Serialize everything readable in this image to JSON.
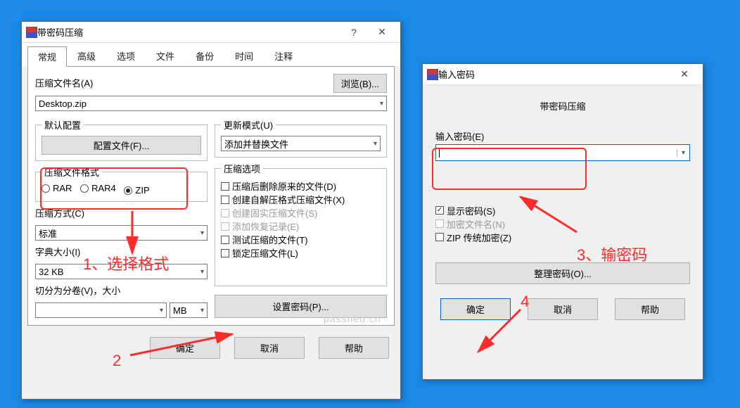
{
  "main": {
    "title": "带密码压缩",
    "tabs": [
      "常规",
      "高级",
      "选项",
      "文件",
      "备份",
      "时间",
      "注释"
    ],
    "activeTab": 0,
    "archiveNameLabel": "压缩文件名(A)",
    "browse": "浏览(B)...",
    "archiveName": "Desktop.zip",
    "defaultCfg": {
      "legend": "默认配置",
      "profiles": "配置文件(F)..."
    },
    "updateMode": {
      "legend": "更新模式(U)",
      "value": "添加并替换文件"
    },
    "format": {
      "legend": "压缩文件格式",
      "options": [
        "RAR",
        "RAR4",
        "ZIP"
      ],
      "selected": 2
    },
    "compressOptions": {
      "legend": "压缩选项",
      "items": [
        {
          "label": "压缩后删除原来的文件(D)",
          "checked": false,
          "disabled": false
        },
        {
          "label": "创建自解压格式压缩文件(X)",
          "checked": false,
          "disabled": false
        },
        {
          "label": "创建固实压缩文件(S)",
          "checked": false,
          "disabled": true
        },
        {
          "label": "添加恢复记录(E)",
          "checked": false,
          "disabled": true
        },
        {
          "label": "测试压缩的文件(T)",
          "checked": false,
          "disabled": false
        },
        {
          "label": "锁定压缩文件(L)",
          "checked": false,
          "disabled": false
        }
      ]
    },
    "method": {
      "label": "压缩方式(C)",
      "value": "标准"
    },
    "dict": {
      "label": "字典大小(I)",
      "value": "32 KB"
    },
    "split": {
      "label": "切分为分卷(V)，大小",
      "value": "",
      "unit": "MB"
    },
    "setPassword": "设置密码(P)...",
    "ok": "确定",
    "cancel": "取消",
    "help": "帮助"
  },
  "pw": {
    "title": "输入密码",
    "heading": "带密码压缩",
    "enterLabel": "输入密码(E)",
    "show": {
      "label": "显示密码(S)",
      "checked": true
    },
    "encryptNames": {
      "label": "加密文件名(N)",
      "disabled": true
    },
    "zipLegacy": {
      "label": "ZIP 传统加密(Z)",
      "checked": false
    },
    "organize": "整理密码(O)...",
    "ok": "确定",
    "cancel": "取消",
    "help": "帮助"
  },
  "annotations": {
    "a1": "1、选择格式",
    "a2": "2",
    "a3": "3、输密码",
    "a4": "4"
  },
  "watermark": "passneo.cn"
}
